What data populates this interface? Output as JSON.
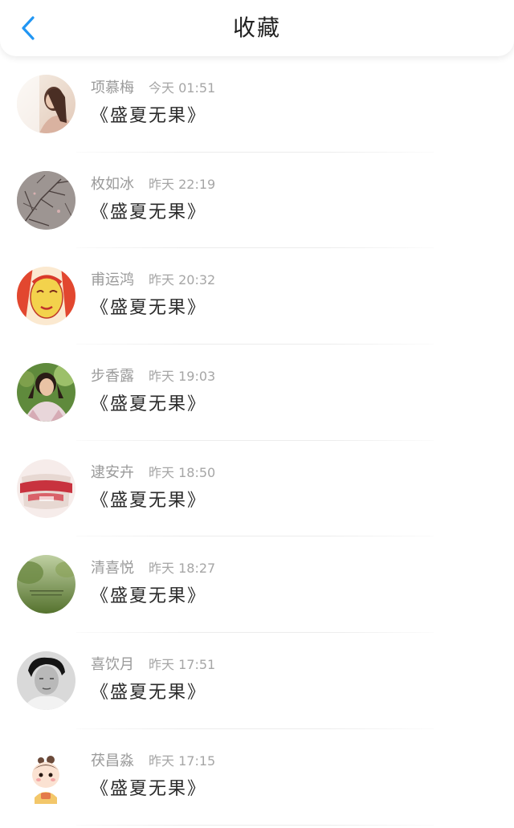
{
  "header": {
    "title": "收藏",
    "back_icon": "chevron-left-icon",
    "accent_color": "#2196F3"
  },
  "favorites": [
    {
      "name": "项慕梅",
      "time": "今天 01:51",
      "content": "《盛夏无果》",
      "avatar": "girl-window-photo"
    },
    {
      "name": "枚如冰",
      "time": "昨天 22:19",
      "content": "《盛夏无果》",
      "avatar": "branches-photo"
    },
    {
      "name": "甫运鸿",
      "time": "昨天 20:32",
      "content": "《盛夏无果》",
      "avatar": "painted-face-illustration"
    },
    {
      "name": "步香露",
      "time": "昨天 19:03",
      "content": "《盛夏无果》",
      "avatar": "girl-pigtails-photo"
    },
    {
      "name": "逮安卉",
      "time": "昨天 18:50",
      "content": "《盛夏无果》",
      "avatar": "red-ribbon-cake-photo"
    },
    {
      "name": "清喜悦",
      "time": "昨天 18:27",
      "content": "《盛夏无果》",
      "avatar": "green-field-photo"
    },
    {
      "name": "喜饮月",
      "time": "昨天 17:51",
      "content": "《盛夏无果》",
      "avatar": "boy-portrait-photo"
    },
    {
      "name": "茯昌淼",
      "time": "昨天 17:15",
      "content": "《盛夏无果》",
      "avatar": "cartoon-baby-illustration"
    }
  ]
}
